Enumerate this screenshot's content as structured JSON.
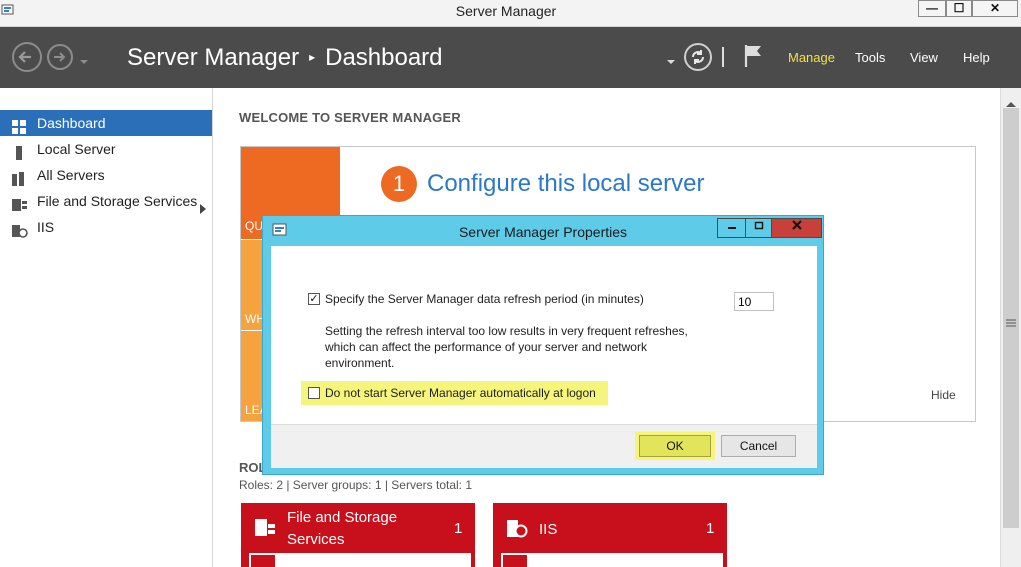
{
  "window": {
    "title": "Server Manager",
    "minimize": "—",
    "maximize": "☐",
    "close": "✕"
  },
  "header": {
    "breadcrumb_app": "Server Manager",
    "breadcrumb_sep": "▸",
    "breadcrumb_page": "Dashboard",
    "menus": {
      "manage": "Manage",
      "tools": "Tools",
      "view": "View",
      "help": "Help"
    },
    "accent_color": "#f0e04a"
  },
  "sidebar": {
    "items": [
      {
        "label": "Dashboard",
        "icon": "dashboard-icon",
        "selected": true
      },
      {
        "label": "Local Server",
        "icon": "server-icon"
      },
      {
        "label": "All Servers",
        "icon": "servers-icon"
      },
      {
        "label": "File and Storage Services",
        "icon": "storage-icon",
        "has_submenu": true
      },
      {
        "label": "IIS",
        "icon": "iis-icon"
      }
    ]
  },
  "main": {
    "welcome_heading": "WELCOME TO SERVER MANAGER",
    "quick_start_partials": [
      "QU",
      "WH",
      "LEA"
    ],
    "step_number": "1",
    "step_text": "Configure this local server",
    "hide_link": "Hide",
    "roles_heading_partial": "ROL",
    "roles_summary": "Roles: 2   |   Server groups: 1   |   Servers total: 1",
    "tiles": [
      {
        "name_line1": "File and Storage",
        "name_line2": "Services",
        "count": "1"
      },
      {
        "name_line1": "IIS",
        "name_line2": "",
        "count": "1"
      }
    ]
  },
  "dialog": {
    "title": "Server Manager Properties",
    "refresh_checkbox_label": "Specify the Server Manager data refresh period (in minutes)",
    "refresh_checked": true,
    "refresh_value": "10",
    "note_line1": "Setting the refresh interval too low results in very frequent refreshes,",
    "note_line2": "which can affect the performance of your server and network",
    "note_line3": "environment.",
    "autostart_label": "Do not start Server Manager automatically at logon",
    "autostart_checked": false,
    "ok_label": "OK",
    "cancel_label": "Cancel",
    "highlight_color": "#f6f57b",
    "frame_color": "#5ecbe9"
  },
  "colors": {
    "tile_red": "#c8101d",
    "quickstart_orange": "#ee6a22",
    "selection_blue": "#2a6fb8"
  }
}
